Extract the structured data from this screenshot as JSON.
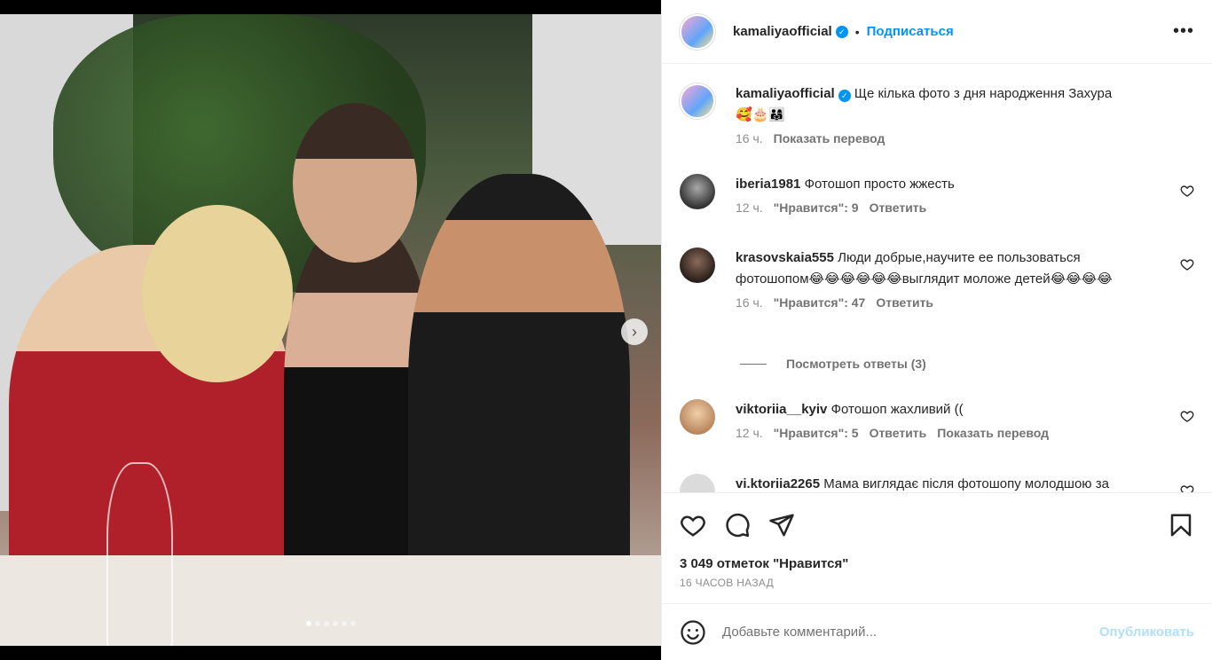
{
  "post": {
    "author": "kamaliyaofficial",
    "follow_label": "Подписаться",
    "bullet": "•",
    "more_label": "•••",
    "caption": "Ще кілька фото з дня народження Захура",
    "caption_emoji": "🥰🎂👨‍👩‍👧",
    "caption_time": "16 ч.",
    "caption_translate": "Показать перевод",
    "likes": "3 049 отметок \"Нравится\"",
    "time_ago": "16 ЧАСОВ НАЗАД",
    "carousel_dots": 6,
    "active_dot": 0
  },
  "comments": [
    {
      "user": "iberia1981",
      "text": "Фотошоп просто жжесть",
      "time": "12 ч.",
      "likes": "\"Нравится\": 9",
      "reply": "Ответить",
      "translate": ""
    },
    {
      "user": "krasovskaia555",
      "text": "Люди добрые,научите ее пользоваться фотошопом😂😂😂😂😂😂выглядит моложе детей😂😂😂😂",
      "time": "16 ч.",
      "likes": "\"Нравится\": 47",
      "reply": "Ответить",
      "translate": ""
    },
    {
      "user": "viktoriia__kyiv",
      "text": "Фотошоп жахливий ((",
      "time": "12 ч.",
      "likes": "\"Нравится\": 5",
      "reply": "Ответить",
      "translate": "Показать перевод"
    },
    {
      "user": "vi.ktoriia2265",
      "text": "Мама виглядає після фотошопу молодшою за",
      "time": "",
      "likes": "",
      "reply": "",
      "translate": ""
    }
  ],
  "view_replies": "Посмотреть ответы (3)",
  "compose": {
    "placeholder": "Добавьте комментарий...",
    "publish": "Опубликовать"
  },
  "colors": {
    "accent": "#0095f6",
    "publish_disabled": "#b2dffc",
    "muted": "#8e8e8e"
  },
  "icons": [
    "heart-icon",
    "comment-icon",
    "share-icon",
    "bookmark-icon",
    "emoji-icon",
    "verified-icon",
    "more-icon",
    "chevron-right-icon"
  ]
}
